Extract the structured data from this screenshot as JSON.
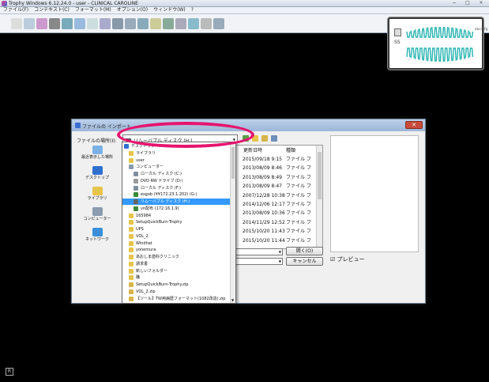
{
  "app": {
    "title": "Trophy Windows 6.12.24.0 - user - CLINICAL CAROLINE",
    "menu": [
      "ファイル(F)",
      "コンテキスト(C)",
      "フォーマット(M)",
      "オプション(O)",
      "ウィンドウ(W)",
      "?"
    ],
    "window_buttons": [
      "−",
      "□",
      "×"
    ]
  },
  "toolbar": {
    "buttons": [
      "new-patient",
      "patient-file",
      "image-acquire",
      "dropdown",
      "ruler",
      "image-edit",
      "ruler2",
      "image-view",
      "layout-full",
      "layout-quad",
      "layout-grid",
      "annotation",
      "display",
      "print",
      "image-export",
      "scanner",
      "exit"
    ]
  },
  "thumbnail": {
    "flags": "SS",
    "side_dots": "abcdefg"
  },
  "status": {
    "r_label": "R"
  },
  "dialog": {
    "title": "ファイルの インポート",
    "close_label": "✕",
    "lookin_label": "ファイルの場所(I):",
    "lookin_value": "リムーバブル ディスク (H:)",
    "places": [
      {
        "label": "最近表示した場所",
        "icon": "recent-places-icon",
        "color": "#7bb0e6"
      },
      {
        "label": "デスクトップ",
        "icon": "desktop-icon",
        "color": "#2f6fcf"
      },
      {
        "label": "ライブラリ",
        "icon": "libraries-icon",
        "color": "#e7c44a"
      },
      {
        "label": "コンピューター",
        "icon": "computer-icon",
        "color": "#8b9bb0"
      },
      {
        "label": "ネットワーク",
        "icon": "network-icon",
        "color": "#3a8fd8"
      }
    ],
    "columns": {
      "date": "更新日時",
      "type": "種類"
    },
    "rows": [
      {
        "date": "2015/09/18 9:15",
        "type": "ファイル フ"
      },
      {
        "date": "2013/08/09 8:46",
        "type": "ファイル フ"
      },
      {
        "date": "2013/08/09 8:49",
        "type": "ファイル フ"
      },
      {
        "date": "2013/08/09 8:47",
        "type": "ファイル フ"
      },
      {
        "date": "2007/12/28 10:38",
        "type": "ファイル フ"
      },
      {
        "date": "2014/12/06 12:17",
        "type": "ファイル フ"
      },
      {
        "date": "2013/08/09 10:36",
        "type": "ファイル フ"
      },
      {
        "date": "2014/11/29 12:52",
        "type": "ファイル フ"
      },
      {
        "date": "2015/10/20 11:43",
        "type": "ファイル フ"
      },
      {
        "date": "2015/10/20 11:44",
        "type": "ファイル フ"
      }
    ],
    "open_label": "開く(O)",
    "cancel_label": "キャンセル",
    "preview_label": "☑ プレビュー"
  },
  "dropdown": {
    "items": [
      {
        "label": "デスクトップ",
        "indent": 0,
        "icon_color": "#2f6fcf",
        "selected": false
      },
      {
        "label": "ライブラリ",
        "indent": 1,
        "icon_color": "#e7c44a",
        "selected": false
      },
      {
        "label": "user",
        "indent": 1,
        "icon_color": "#e7c44a",
        "selected": false
      },
      {
        "label": "コンピューター",
        "indent": 1,
        "icon_color": "#8b9bb0",
        "selected": false
      },
      {
        "label": "ローカル ディスク (C:)",
        "indent": 2,
        "icon_color": "#7f8f9f",
        "selected": false
      },
      {
        "label": "DVD RW ドライブ (D:)",
        "indent": 2,
        "icon_color": "#9a9a9a",
        "selected": false
      },
      {
        "label": "ローカル ディスク (F:)",
        "indent": 2,
        "icon_color": "#7f8f9f",
        "selected": false
      },
      {
        "label": "esgob (¥¥172.23.1.202) (G:)",
        "indent": 2,
        "icon_color": "#3a8a3a",
        "selected": false
      },
      {
        "label": "リムーバブル ディスク (H:)",
        "indent": 2,
        "icon_color": "#666666",
        "selected": true
      },
      {
        "label": "vn配布 (172.16.1.9)",
        "indent": 2,
        "icon_color": "#3a8a3a",
        "selected": false
      },
      {
        "label": "165984",
        "indent": 1,
        "icon_color": "#e7c44a",
        "selected": false
      },
      {
        "label": "SetupQuickBurn-Trophy",
        "indent": 1,
        "icon_color": "#e7c44a",
        "selected": false
      },
      {
        "label": "UPS",
        "indent": 1,
        "icon_color": "#e7c44a",
        "selected": false
      },
      {
        "label": "VOL_2",
        "indent": 1,
        "icon_color": "#e7c44a",
        "selected": false
      },
      {
        "label": "Windhat",
        "indent": 1,
        "icon_color": "#e7c44a",
        "selected": false
      },
      {
        "label": "yonemura",
        "indent": 1,
        "icon_color": "#e7c44a",
        "selected": false
      },
      {
        "label": "あおしま歯科クリニック",
        "indent": 1,
        "icon_color": "#e7c44a",
        "selected": false
      },
      {
        "label": "請求書",
        "indent": 1,
        "icon_color": "#e7c44a",
        "selected": false
      },
      {
        "label": "新しいフォルダー",
        "indent": 1,
        "icon_color": "#e7c44a",
        "selected": false
      },
      {
        "label": "職",
        "indent": 1,
        "icon_color": "#e7c44a",
        "selected": false
      },
      {
        "label": "SetupQuickBurn-Trophy.zip",
        "indent": 1,
        "icon_color": "#d8b44a",
        "selected": false
      },
      {
        "label": "VOL_2.zip",
        "indent": 1,
        "icon_color": "#d8b44a",
        "selected": false
      },
      {
        "label": "【ツール】TW用病歴フォーマット(1082改造).zip",
        "indent": 1,
        "icon_color": "#d8b44a",
        "selected": false
      }
    ]
  },
  "colors": {
    "highlight": "#e6146f",
    "selection": "#3399ff",
    "teeth": "#27b3b0"
  }
}
